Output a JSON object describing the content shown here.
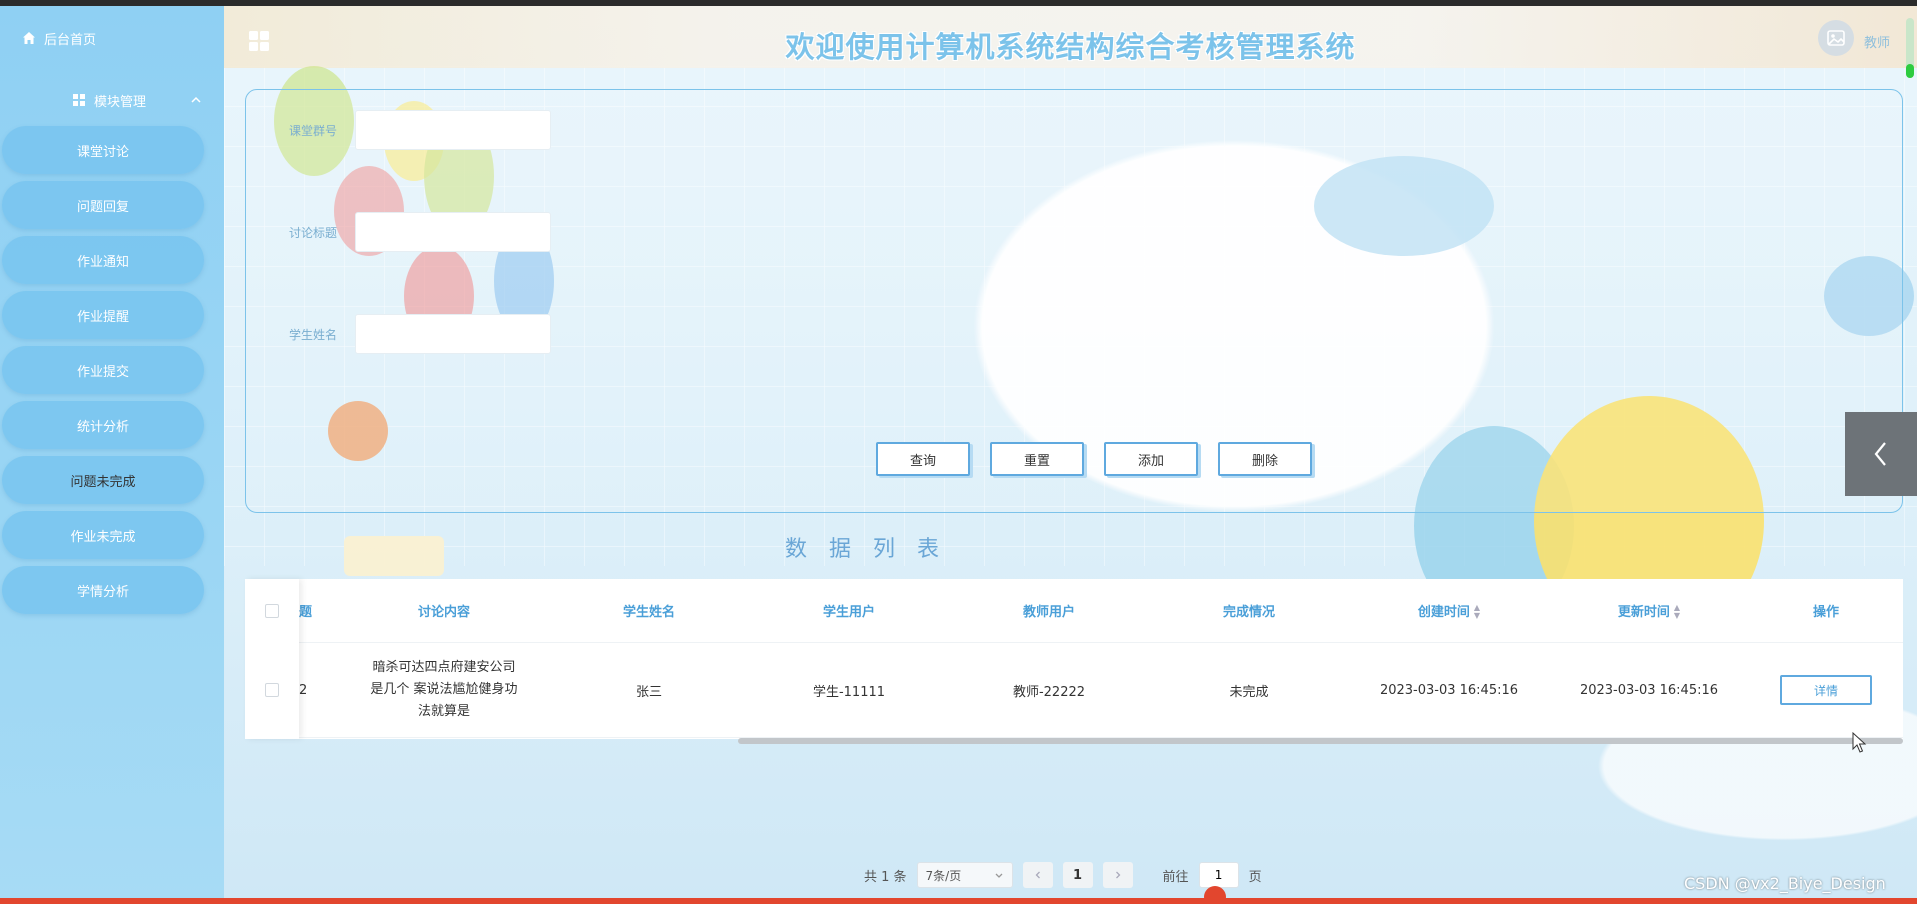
{
  "sidebar": {
    "home_label": "后台首页",
    "module_label": "模块管理",
    "items": [
      {
        "label": "课堂讨论"
      },
      {
        "label": "问题回复"
      },
      {
        "label": "作业通知"
      },
      {
        "label": "作业提醒"
      },
      {
        "label": "作业提交"
      },
      {
        "label": "统计分析"
      },
      {
        "label": "问题未完成"
      },
      {
        "label": "作业未完成"
      },
      {
        "label": "学情分析"
      }
    ]
  },
  "header": {
    "title": "欢迎使用计算机系统结构综合考核管理系统",
    "user_role": "教师"
  },
  "search": {
    "fields": [
      {
        "label": "课堂群号",
        "value": ""
      },
      {
        "label": "讨论标题",
        "value": ""
      },
      {
        "label": "学生姓名",
        "value": ""
      }
    ],
    "buttons": {
      "query": "查询",
      "reset": "重置",
      "add": "添加",
      "delete": "删除"
    }
  },
  "list": {
    "title": "数据列表",
    "columns": [
      "题",
      "讨论内容",
      "学生姓名",
      "学生用户",
      "教师用户",
      "完成情况",
      "创建时间",
      "更新时间",
      "操作"
    ],
    "rows": [
      {
        "partial": "2",
        "content": "暗杀可达四点府建安公司是几个 案说法尴尬健身功法就算是",
        "student_name": "张三",
        "student_user": "学生-11111",
        "teacher_user": "教师-22222",
        "status": "未完成",
        "created": "2023-03-03 16:45:16",
        "updated": "2023-03-03 16:45:16",
        "action": "详情"
      }
    ]
  },
  "pagination": {
    "total": "共 1 条",
    "page_size": "7条/页",
    "current_page": "1",
    "goto_prefix": "前往",
    "goto_value": "1",
    "goto_suffix": "页"
  },
  "watermark": "CSDN @vx2_Biye_Design",
  "colors": {
    "accent": "#4a9fd8",
    "sidebar": "#8fd0f3",
    "title": "#7cc3ea"
  }
}
